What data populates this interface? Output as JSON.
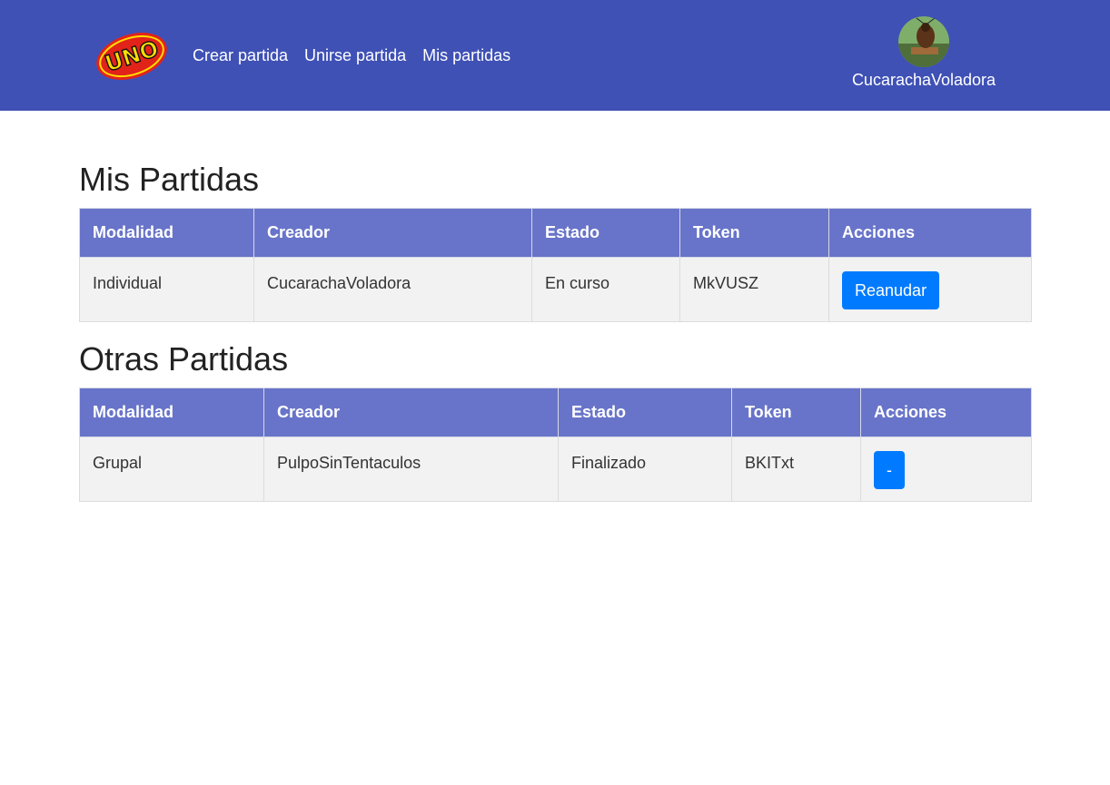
{
  "navbar": {
    "logo_text": "UNO",
    "links": [
      "Crear partida",
      "Unirse partida",
      "Mis partidas"
    ],
    "user": {
      "name": "CucarachaVoladora"
    },
    "colors": {
      "background": "#3f51b5"
    }
  },
  "mis_partidas": {
    "title": "Mis Partidas",
    "columns": [
      "Modalidad",
      "Creador",
      "Estado",
      "Token",
      "Acciones"
    ],
    "rows": [
      {
        "modalidad": "Individual",
        "creador": "CucarachaVoladora",
        "estado": "En curso",
        "token": "MkVUSZ",
        "accion": "Reanudar"
      }
    ]
  },
  "otras_partidas": {
    "title": "Otras Partidas",
    "columns": [
      "Modalidad",
      "Creador",
      "Estado",
      "Token",
      "Acciones"
    ],
    "rows": [
      {
        "modalidad": "Grupal",
        "creador": "PulpoSinTentaculos",
        "estado": "Finalizado",
        "token": "BKITxt",
        "accion": "-"
      }
    ]
  },
  "colors": {
    "header": "#6874c9",
    "button": "#007bff",
    "row": "#f2f2f2"
  }
}
